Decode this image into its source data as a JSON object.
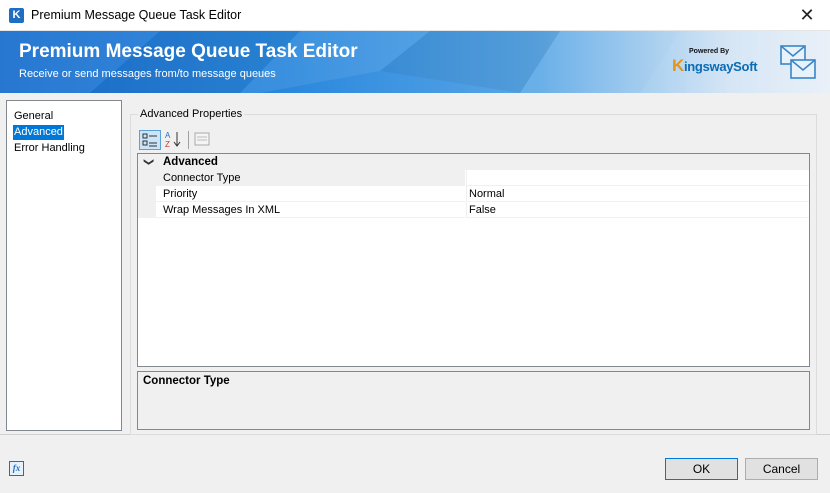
{
  "window": {
    "title": "Premium Message Queue Task Editor",
    "close_glyph": "✕",
    "app_icon_letter": "K"
  },
  "banner": {
    "title": "Premium Message Queue Task Editor",
    "subtitle": "Receive or send messages from/to message queues",
    "brand_small": "Powered By",
    "brand_k": "K",
    "brand_rest": "ingswaySoft"
  },
  "nav": {
    "items": [
      {
        "label": "General",
        "selected": false
      },
      {
        "label": "Advanced",
        "selected": true
      },
      {
        "label": "Error Handling",
        "selected": false
      }
    ]
  },
  "group": {
    "label": "Advanced Properties"
  },
  "toolbar": {
    "categorized_icon": "categorized-icon",
    "alphabetical_icon": "alphabetical-icon",
    "property_pages_icon": "property-pages-icon"
  },
  "grid": {
    "category": "Advanced",
    "properties": [
      {
        "name": "Connector Type",
        "value": ""
      },
      {
        "name": "Priority",
        "value": "Normal"
      },
      {
        "name": "Wrap Messages In XML",
        "value": "False"
      }
    ]
  },
  "description": {
    "title": "Connector Type"
  },
  "footer": {
    "fx_label": "fx",
    "ok": "OK",
    "cancel": "Cancel"
  }
}
